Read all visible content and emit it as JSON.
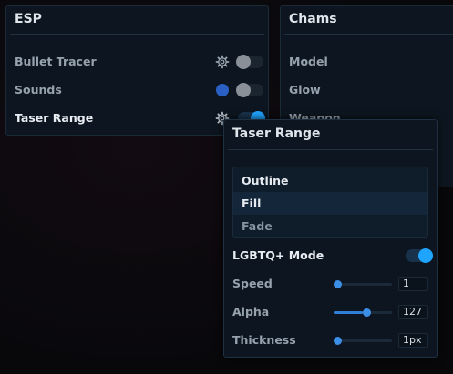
{
  "esp": {
    "title": "ESP",
    "items": [
      {
        "label": "Bullet Tracer",
        "has_gear": true,
        "toggle": false
      },
      {
        "label": "Sounds",
        "has_color": true,
        "color": "#2a5fc4",
        "toggle": false
      },
      {
        "label": "Taser Range",
        "has_gear": true,
        "toggle": true
      }
    ]
  },
  "chams": {
    "title": "Chams",
    "items": [
      "Model",
      "Glow",
      "Weapon"
    ]
  },
  "popup": {
    "title": "Taser Range",
    "list": [
      "Outline",
      "Fill",
      "Fade"
    ],
    "lgbtq": {
      "label": "LGBTQ+ Mode",
      "on": true
    },
    "sliders": [
      {
        "label": "Speed",
        "value": "1",
        "fraction": 0.0
      },
      {
        "label": "Alpha",
        "value": "127",
        "fraction": 0.5
      },
      {
        "label": "Thickness",
        "value": "1px",
        "fraction": 0.0
      }
    ]
  },
  "colors": {
    "accent": "#1fa4ff",
    "slider": "#3c8fe6",
    "panel_bg": "#0d1620"
  }
}
